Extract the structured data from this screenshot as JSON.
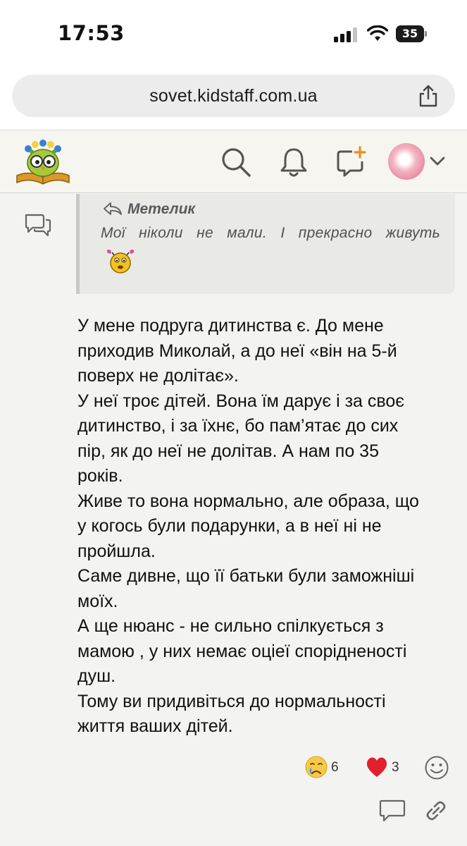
{
  "status_bar": {
    "time": "17:53",
    "battery": "35",
    "icons": [
      "cellular-signal-icon",
      "wifi-icon",
      "battery-icon"
    ]
  },
  "browser": {
    "url": "sovet.kidstaff.com.ua",
    "share_icon": "share-icon"
  },
  "site_header": {
    "logo_icon": "owl-book-logo",
    "icons": [
      "search-icon",
      "bell-icon",
      "new-message-icon",
      "chevron-down-icon"
    ]
  },
  "post": {
    "quote": {
      "author": "Метелик",
      "text": "Мої ніколи не мали. І прекрасно живуть",
      "emoji": "smiley-emoji"
    },
    "body_lines": [
      "У мене подруга дитинства є. До мене",
      "приходив Миколай, а до неї «він на 5-й",
      "поверх не долітає».",
      "У неї троє дітей. Вона їм дарує і за своє",
      "дитинство, і за їхнє, бо пам’ятає до сих",
      "пір, як до неї не долітав. А нам по 35",
      "років.",
      "Живе то вона нормально, але образа, що",
      "у когось були подарунки, а в неї ні не",
      "пройшла.",
      "Саме дивне, що її батьки були заможніші",
      "моїх.",
      "А ще нюанс - не сильно спілкується з",
      "мамою , у них немає оціеї спорідненості",
      "душ.",
      "Тому ви придивіться до нормальності",
      "життя ваших дітей."
    ],
    "reactions": [
      {
        "icon": "crying-face-icon",
        "count": "6"
      },
      {
        "icon": "heart-icon",
        "count": "3"
      }
    ],
    "colors": {
      "heart": "#e0202c",
      "background": "#f3f3f1",
      "quote_bg": "#e9e9e6"
    }
  }
}
